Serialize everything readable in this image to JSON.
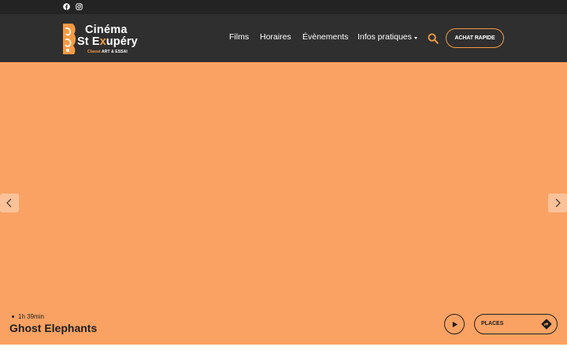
{
  "topbar": {
    "social_icons": [
      "facebook-icon",
      "instagram-icon"
    ]
  },
  "brand": {
    "name_line1": "Cinéma",
    "name_line2_prefix": "St E",
    "name_line2_accent": "x",
    "name_line2_suffix": "upéry",
    "tagline_accent": "Classé",
    "tagline": "ART & ESSAI",
    "accent_color": "#f59b45"
  },
  "nav": {
    "items": [
      {
        "label": "Films"
      },
      {
        "label": "Horaires"
      },
      {
        "label": "Évènements"
      },
      {
        "label": "Infos pratiques"
      }
    ],
    "cta_label": "ACHAT RAPIDE"
  },
  "hero": {
    "background_color": "#f9a263",
    "duration": "1h 39min",
    "title": "Ghost Elephants",
    "places_label": "PLACES"
  }
}
